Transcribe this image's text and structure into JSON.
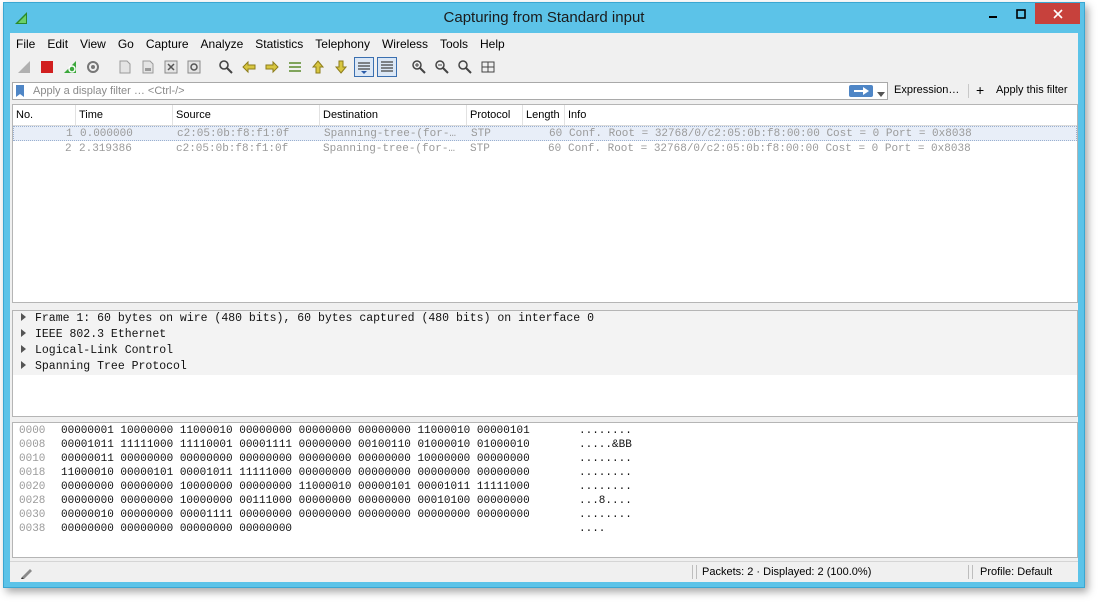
{
  "window": {
    "title": "Capturing from Standard input"
  },
  "menu": [
    "File",
    "Edit",
    "View",
    "Go",
    "Capture",
    "Analyze",
    "Statistics",
    "Telephony",
    "Wireless",
    "Tools",
    "Help"
  ],
  "toolbar": {
    "icons": [
      "shark-fin-start-icon",
      "stop-capture-icon",
      "restart-capture-icon",
      "capture-options-icon",
      "open-file-icon",
      "save-file-icon",
      "close-file-icon",
      "reload-file-icon",
      "find-packet-icon",
      "go-back-icon",
      "go-forward-icon",
      "go-to-packet-icon",
      "first-packet-icon",
      "last-packet-icon",
      "auto-scroll-icon",
      "colorize-icon",
      "zoom-in-icon",
      "zoom-out-icon",
      "normal-size-icon",
      "resize-columns-icon"
    ]
  },
  "filter": {
    "placeholder": "Apply a display filter … <Ctrl-/>",
    "expression_label": "Expression…",
    "apply_label": "Apply this filter",
    "plus": "+"
  },
  "packet_list": {
    "columns": [
      "No.",
      "Time",
      "Source",
      "Destination",
      "Protocol",
      "Length",
      "Info"
    ],
    "rows": [
      {
        "no": "1",
        "time": "0.000000",
        "source": "c2:05:0b:f8:f1:0f",
        "destination": "Spanning-tree-(for-…",
        "protocol": "STP",
        "length": "60",
        "info": "Conf. Root = 32768/0/c2:05:0b:f8:00:00  Cost = 0  Port = 0x8038"
      },
      {
        "no": "2",
        "time": "2.319386",
        "source": "c2:05:0b:f8:f1:0f",
        "destination": "Spanning-tree-(for-…",
        "protocol": "STP",
        "length": "60",
        "info": "Conf. Root = 32768/0/c2:05:0b:f8:00:00  Cost = 0  Port = 0x8038"
      }
    ]
  },
  "details": [
    "Frame 1: 60 bytes on wire (480 bits), 60 bytes captured (480 bits) on interface 0",
    "IEEE 802.3 Ethernet",
    "Logical-Link Control",
    "Spanning Tree Protocol"
  ],
  "hex": [
    {
      "offset": "0000",
      "bytes": "00000001 10000000 11000010 00000000 00000000 00000000 11000010 00000101",
      "ascii": "........"
    },
    {
      "offset": "0008",
      "bytes": "00001011 11111000 11110001 00001111 00000000 00100110 01000010 01000010",
      "ascii": ".....&BB"
    },
    {
      "offset": "0010",
      "bytes": "00000011 00000000 00000000 00000000 00000000 00000000 10000000 00000000",
      "ascii": "........"
    },
    {
      "offset": "0018",
      "bytes": "11000010 00000101 00001011 11111000 00000000 00000000 00000000 00000000",
      "ascii": "........"
    },
    {
      "offset": "0020",
      "bytes": "00000000 00000000 10000000 00000000 11000010 00000101 00001011 11111000",
      "ascii": "........"
    },
    {
      "offset": "0028",
      "bytes": "00000000 00000000 10000000 00111000 00000000 00000000 00010100 00000000",
      "ascii": "...8...."
    },
    {
      "offset": "0030",
      "bytes": "00000010 00000000 00001111 00000000 00000000 00000000 00000000 00000000",
      "ascii": "........"
    },
    {
      "offset": "0038",
      "bytes": "00000000 00000000 00000000 00000000",
      "ascii": "...."
    }
  ],
  "status": {
    "packets": "Packets: 2 · Displayed: 2 (100.0%)",
    "profile": "Profile: Default"
  },
  "colors": {
    "titlebar": "#5cc3e8",
    "close": "#c7413c",
    "selected_row": "#e8eef8"
  }
}
